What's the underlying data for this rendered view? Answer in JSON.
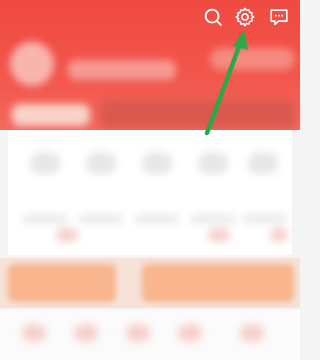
{
  "header": {
    "background_color": "#f04a42",
    "icons": {
      "search": "search-icon",
      "settings": "gear-icon",
      "messages": "chat-bubble-icon"
    }
  },
  "annotation": {
    "arrow_color": "#2aa84a",
    "points_to": "gear-icon"
  },
  "colors": {
    "accent_orange": "#f8b58e",
    "page_background": "#f4f4f4"
  }
}
